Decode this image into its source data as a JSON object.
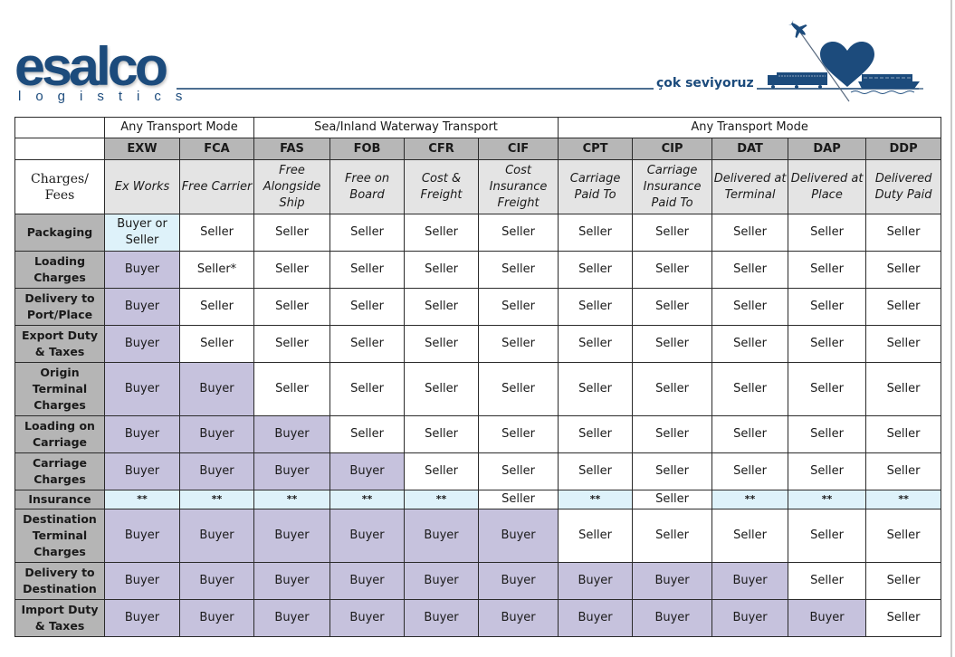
{
  "header": {
    "logo_word": "esalco",
    "logo_sub": "logistics",
    "slogan": "çok seviyoruz",
    "illustration_icons": [
      "airplane-icon",
      "heart-icon",
      "truck-icon",
      "ship-icon"
    ]
  },
  "colors": {
    "brand_blue": "#1c4b7c",
    "buyer_fill": "#c6c2dd",
    "seller_fill": "#ffffff",
    "shared_fill": "#def2fa",
    "label_fill": "#b5b5b5",
    "code_fill": "#b7b7b7",
    "name_fill": "#e4e4e4"
  },
  "table": {
    "groups": [
      {
        "label": "Any Transport Mode",
        "span": 2
      },
      {
        "label": "Sea/Inland Waterway Transport",
        "span": 4
      },
      {
        "label": "Any Transport Mode",
        "span": 5
      }
    ],
    "row_header_title": "Charges/ Fees",
    "terms": [
      {
        "code": "EXW",
        "name": "Ex Works"
      },
      {
        "code": "FCA",
        "name": "Free Carrier"
      },
      {
        "code": "FAS",
        "name": "Free Alongside Ship"
      },
      {
        "code": "FOB",
        "name": "Free on Board"
      },
      {
        "code": "CFR",
        "name": "Cost & Freight"
      },
      {
        "code": "CIF",
        "name": "Cost Insurance Freight"
      },
      {
        "code": "CPT",
        "name": "Carriage Paid To"
      },
      {
        "code": "CIP",
        "name": "Carriage Insurance Paid To"
      },
      {
        "code": "DAT",
        "name": "Delivered at Terminal"
      },
      {
        "code": "DAP",
        "name": "Delivered at Place"
      },
      {
        "code": "DDP",
        "name": "Delivered Duty Paid"
      }
    ],
    "rows": [
      {
        "label": "Packaging",
        "cells": [
          "Buyer or Seller",
          "Seller",
          "Seller",
          "Seller",
          "Seller",
          "Seller",
          "Seller",
          "Seller",
          "Seller",
          "Seller",
          "Seller"
        ]
      },
      {
        "label": "Loading Charges",
        "cells": [
          "Buyer",
          "Seller*",
          "Seller",
          "Seller",
          "Seller",
          "Seller",
          "Seller",
          "Seller",
          "Seller",
          "Seller",
          "Seller"
        ]
      },
      {
        "label": "Delivery to Port/Place",
        "cells": [
          "Buyer",
          "Seller",
          "Seller",
          "Seller",
          "Seller",
          "Seller",
          "Seller",
          "Seller",
          "Seller",
          "Seller",
          "Seller"
        ]
      },
      {
        "label": "Export Duty & Taxes",
        "cells": [
          "Buyer",
          "Seller",
          "Seller",
          "Seller",
          "Seller",
          "Seller",
          "Seller",
          "Seller",
          "Seller",
          "Seller",
          "Seller"
        ]
      },
      {
        "label": "Origin Terminal Charges",
        "cells": [
          "Buyer",
          "Buyer",
          "Seller",
          "Seller",
          "Seller",
          "Seller",
          "Seller",
          "Seller",
          "Seller",
          "Seller",
          "Seller"
        ]
      },
      {
        "label": "Loading on Carriage",
        "cells": [
          "Buyer",
          "Buyer",
          "Buyer",
          "Seller",
          "Seller",
          "Seller",
          "Seller",
          "Seller",
          "Seller",
          "Seller",
          "Seller"
        ]
      },
      {
        "label": "Carriage Charges",
        "cells": [
          "Buyer",
          "Buyer",
          "Buyer",
          "Buyer",
          "Seller",
          "Seller",
          "Seller",
          "Seller",
          "Seller",
          "Seller",
          "Seller"
        ]
      },
      {
        "label": "Insurance",
        "cells": [
          "**",
          "**",
          "**",
          "**",
          "**",
          "Seller",
          "**",
          "Seller",
          "**",
          "**",
          "**"
        ]
      },
      {
        "label": "Destination Terminal Charges",
        "cells": [
          "Buyer",
          "Buyer",
          "Buyer",
          "Buyer",
          "Buyer",
          "Buyer",
          "Seller",
          "Seller",
          "Seller",
          "Seller",
          "Seller"
        ]
      },
      {
        "label": "Delivery to Destination",
        "cells": [
          "Buyer",
          "Buyer",
          "Buyer",
          "Buyer",
          "Buyer",
          "Buyer",
          "Buyer",
          "Buyer",
          "Buyer",
          "Seller",
          "Seller"
        ]
      },
      {
        "label": "Import Duty & Taxes",
        "cells": [
          "Buyer",
          "Buyer",
          "Buyer",
          "Buyer",
          "Buyer",
          "Buyer",
          "Buyer",
          "Buyer",
          "Buyer",
          "Buyer",
          "Seller"
        ]
      }
    ]
  }
}
